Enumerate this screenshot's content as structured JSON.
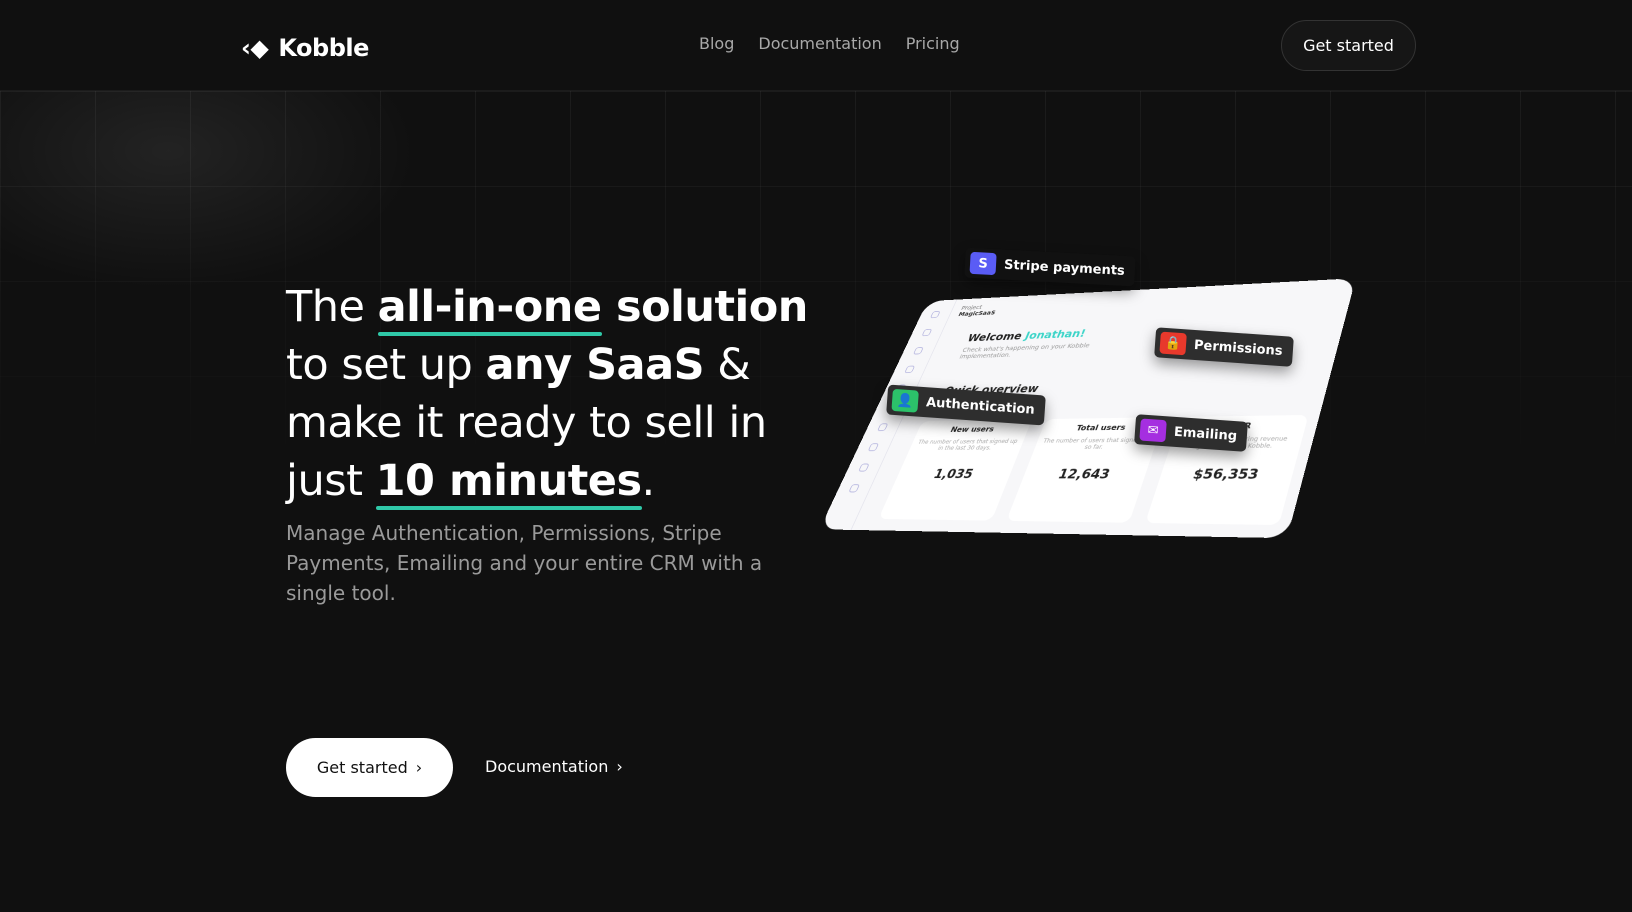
{
  "nav": {
    "brand": "Kobble",
    "links": [
      "Blog",
      "Documentation",
      "Pricing"
    ],
    "cta": "Get started"
  },
  "hero": {
    "l1a": "The ",
    "l1b": "all-in-one",
    "l1c": " solution",
    "l2a": "to set up ",
    "l2b": "any SaaS",
    "l2c": " &",
    "l3": "make it ready to sell in",
    "l4a": "just ",
    "l4b": "10 minutes",
    "l4c": ".",
    "subtitle": "Manage Authentication, Permissions, Stripe Payments, Emailing and your entire CRM with a single tool.",
    "primary": "Get started",
    "secondary": "Documentation"
  },
  "mock": {
    "project_label": "Project",
    "project": "MagicSaaS",
    "welcome": "Welcome ",
    "name": "Jonathan!",
    "check": "Check what's happening on your Kobble implementation.",
    "quick": "Quick overview",
    "stats": [
      {
        "title": "New users",
        "desc": "The number of users that signed up in the last 30 days.",
        "value": "1,035"
      },
      {
        "title": "Total users",
        "desc": "The number of users that signed up so far.",
        "value": "12,643"
      },
      {
        "title": "MRR",
        "desc": "The monthly recurring revenue generated with Kobble.",
        "value": "$56,353"
      }
    ],
    "chips": {
      "stripe": "Stripe payments",
      "permissions": "Permissions",
      "auth": "Authentication",
      "email": "Emailing"
    }
  }
}
